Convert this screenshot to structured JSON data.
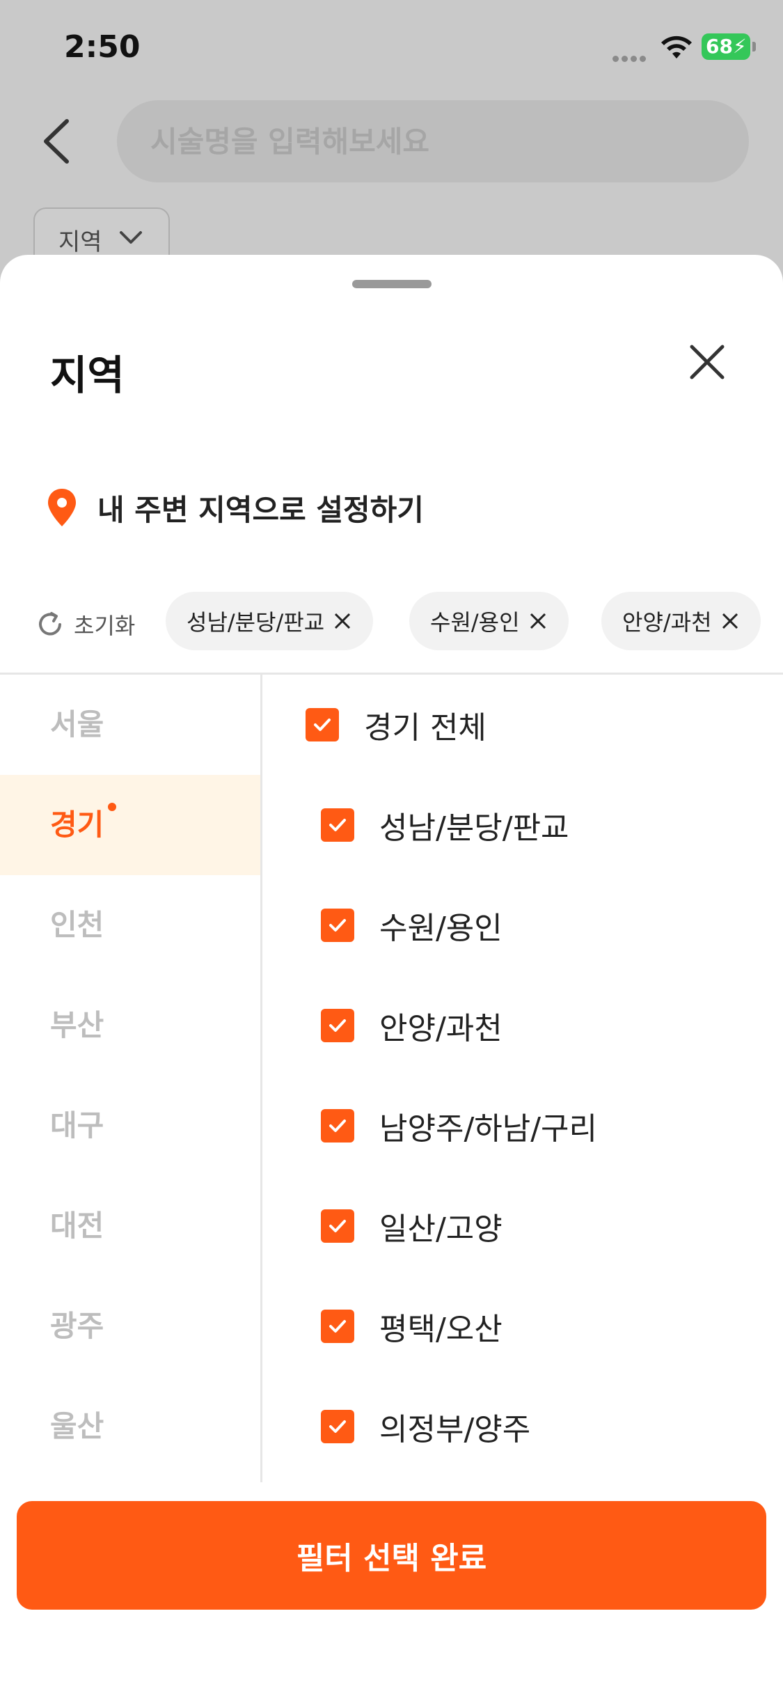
{
  "status_bar": {
    "time": "2:50",
    "battery": "68"
  },
  "search": {
    "placeholder": "시술명을 입력해보세요"
  },
  "filter_chip": {
    "label": "지역"
  },
  "sheet": {
    "title": "지역",
    "nearby_label": "내 주변 지역으로 설정하기",
    "reset_label": "초기화",
    "selected_chips": [
      "성남/분당/판교",
      "수원/용인",
      "안양/과천"
    ],
    "regions": [
      "서울",
      "경기",
      "인천",
      "부산",
      "대구",
      "대전",
      "광주",
      "울산"
    ],
    "active_region": "경기",
    "select_all_label": "경기 전체",
    "sub_regions": [
      "성남/분당/판교",
      "수원/용인",
      "안양/과천",
      "남양주/하남/구리",
      "일산/고양",
      "평택/오산",
      "의정부/양주"
    ],
    "confirm_label": "필터 선택 완료"
  },
  "colors": {
    "accent": "#ff5a14",
    "active_bg": "#fff5e6",
    "battery": "#34c759"
  }
}
